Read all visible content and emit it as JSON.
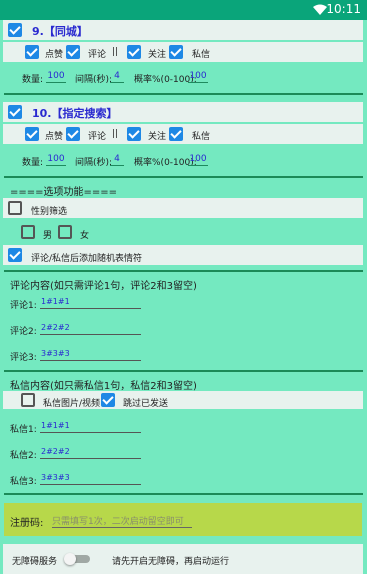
{
  "status_bar": {
    "time": "10:11"
  },
  "group9": {
    "title": "9.【同城】",
    "checks": [
      {
        "label": "点赞",
        "checked": true
      },
      {
        "label": "评论",
        "checked": true
      },
      {
        "label": "关注",
        "checked": true
      },
      {
        "label": "私信",
        "checked": true
      }
    ],
    "separator": "||",
    "count_label": "数量:",
    "count_value": "100",
    "interval_label": "间隔(秒):",
    "interval_value": "4",
    "prob_label": "概率%(0-100):",
    "prob_value": "100"
  },
  "group10": {
    "title": "10.【指定搜索】",
    "checks": [
      {
        "label": "点赞",
        "checked": true
      },
      {
        "label": "评论",
        "checked": true
      },
      {
        "label": "关注",
        "checked": true
      },
      {
        "label": "私信",
        "checked": true
      }
    ],
    "separator": "||",
    "count_label": "数量:",
    "count_value": "100",
    "interval_label": "间隔(秒):",
    "interval_value": "4",
    "prob_label": "概率%(0-100):",
    "prob_value": "100"
  },
  "options": {
    "header": "====选项功能====",
    "gender_filter": "性别筛选",
    "male": "男",
    "female": "女",
    "emoji_label": "评论/私信后添加随机表情符"
  },
  "comments": {
    "header": "评论内容(如只需评论1句，评论2和3留空)",
    "rows": [
      {
        "label": "评论1:",
        "value": "1#1#1"
      },
      {
        "label": "评论2:",
        "value": "2#2#2"
      },
      {
        "label": "评论3:",
        "value": "3#3#3"
      }
    ]
  },
  "messages": {
    "header": "私信内容(如只需私信1句，私信2和3留空)",
    "media_label": "私信图片/视频",
    "skip_label": "跳过已发送",
    "rows": [
      {
        "label": "私信1:",
        "value": "1#1#1"
      },
      {
        "label": "私信2:",
        "value": "2#2#2"
      },
      {
        "label": "私信3:",
        "value": "3#3#3"
      }
    ]
  },
  "register": {
    "label": "注册码:",
    "placeholder": "只需填写1次，二次启动留空即可"
  },
  "accessibility": {
    "label": "无障碍服务",
    "hint": "请先开启无障碍，再启动运行"
  },
  "colors": {
    "background": "#74e9c0",
    "accent": "#1e88e5",
    "title": "#2a2ad0",
    "register_bg": "#b7d84a"
  }
}
